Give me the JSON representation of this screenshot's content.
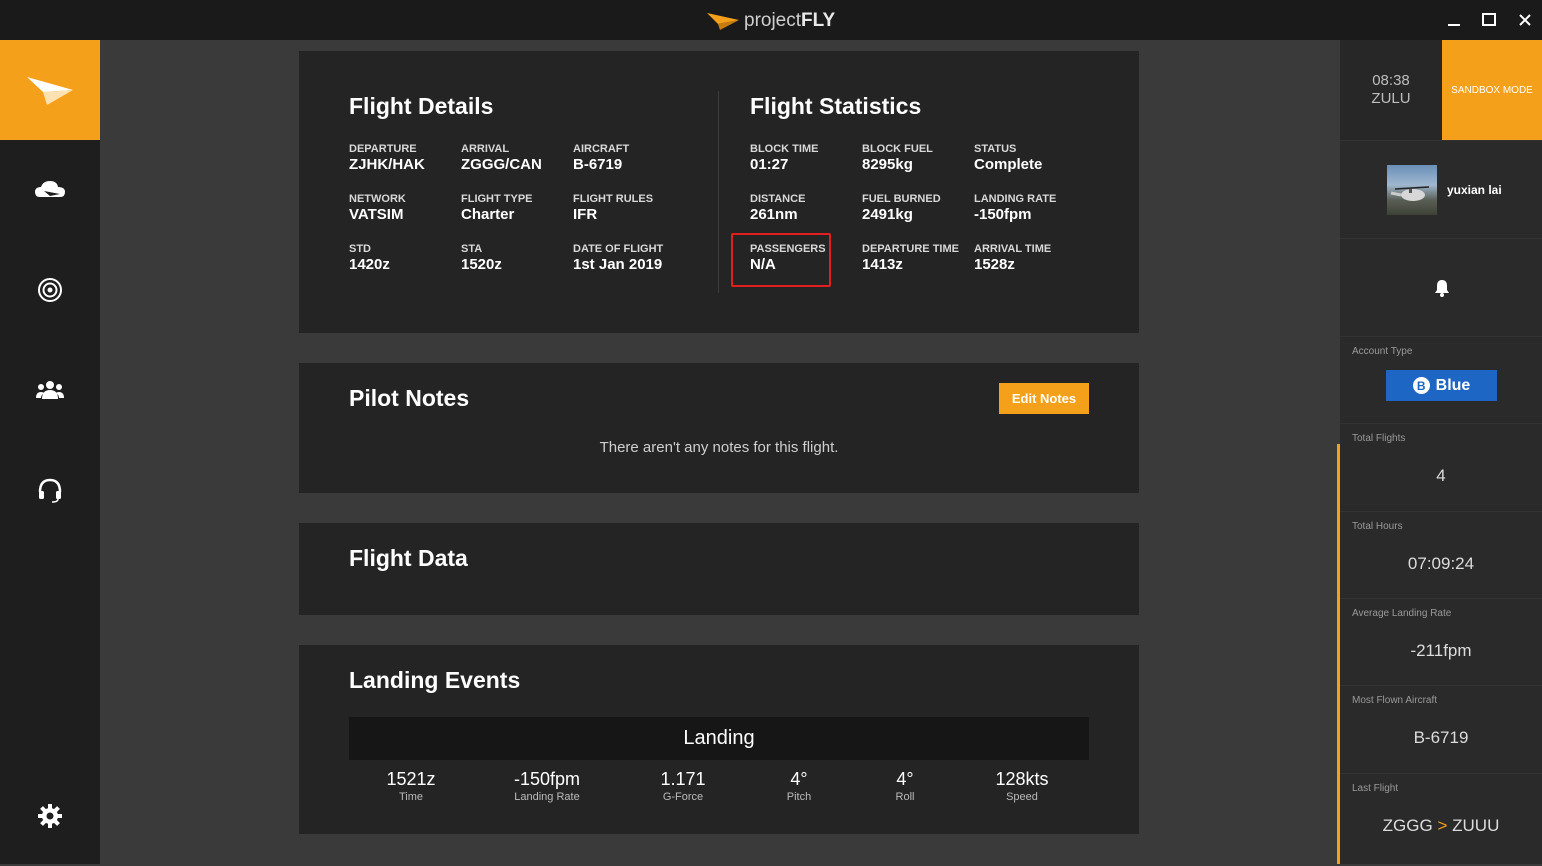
{
  "app": {
    "title_prefix": "project",
    "title_bold": "FLY"
  },
  "sidebar": {
    "items": [
      {
        "name": "brand-plane",
        "icon": "paper-plane-icon"
      },
      {
        "name": "flights",
        "icon": "cloud-plane-icon"
      },
      {
        "name": "radar",
        "icon": "radar-icon"
      },
      {
        "name": "community",
        "icon": "users-icon"
      },
      {
        "name": "support",
        "icon": "headset-icon"
      },
      {
        "name": "settings",
        "icon": "gear-icon"
      }
    ]
  },
  "flight_details": {
    "title": "Flight Details",
    "fields": [
      {
        "label": "DEPARTURE",
        "value": "ZJHK/HAK"
      },
      {
        "label": "ARRIVAL",
        "value": "ZGGG/CAN"
      },
      {
        "label": "AIRCRAFT",
        "value": "B-6719"
      },
      {
        "label": "NETWORK",
        "value": "VATSIM"
      },
      {
        "label": "FLIGHT TYPE",
        "value": "Charter"
      },
      {
        "label": "FLIGHT RULES",
        "value": "IFR"
      },
      {
        "label": "STD",
        "value": "1420z"
      },
      {
        "label": "STA",
        "value": "1520z"
      },
      {
        "label": "DATE OF FLIGHT",
        "value": "1st Jan 2019"
      }
    ]
  },
  "flight_statistics": {
    "title": "Flight Statistics",
    "fields": [
      {
        "label": "BLOCK TIME",
        "value": "01:27"
      },
      {
        "label": "BLOCK FUEL",
        "value": "8295kg"
      },
      {
        "label": "STATUS",
        "value": "Complete"
      },
      {
        "label": "DISTANCE",
        "value": "261nm"
      },
      {
        "label": "FUEL BURNED",
        "value": "2491kg"
      },
      {
        "label": "LANDING RATE",
        "value": "-150fpm"
      },
      {
        "label": "PASSENGERS",
        "value": "N/A"
      },
      {
        "label": "DEPARTURE TIME",
        "value": "1413z"
      },
      {
        "label": "ARRIVAL TIME",
        "value": "1528z"
      }
    ]
  },
  "pilot_notes": {
    "title": "Pilot Notes",
    "edit_label": "Edit Notes",
    "empty_text": "There aren't any notes for this flight."
  },
  "flight_data": {
    "title": "Flight Data"
  },
  "landing_events": {
    "title": "Landing Events",
    "header": "Landing",
    "stats": [
      {
        "value": "1521z",
        "label": "Time"
      },
      {
        "value": "-150fpm",
        "label": "Landing Rate"
      },
      {
        "value": "1.171",
        "label": "G-Force"
      },
      {
        "value": "4°",
        "label": "Pitch"
      },
      {
        "value": "4°",
        "label": "Roll"
      },
      {
        "value": "128kts",
        "label": "Speed"
      }
    ]
  },
  "right_panel": {
    "clock_time": "08:38",
    "clock_zone": "ZULU",
    "sandbox_label": "SANDBOX MODE",
    "username": "yuxian lai",
    "account_type_caption": "Account Type",
    "account_type_value": "Blue",
    "account_badge_letter": "B",
    "total_flights_caption": "Total Flights",
    "total_flights_value": "4",
    "total_hours_caption": "Total Hours",
    "total_hours_value": "07:09:24",
    "avg_landing_caption": "Average Landing Rate",
    "avg_landing_value": "-211fpm",
    "most_flown_caption": "Most Flown Aircraft",
    "most_flown_value": "B-6719",
    "last_flight_caption": "Last Flight",
    "last_flight_from": "ZGGG",
    "last_flight_arrow": ">",
    "last_flight_to": "ZUUU"
  },
  "colors": {
    "accent": "#f5a01a",
    "badge_blue": "#1e66c4",
    "highlight_red": "#e02020"
  }
}
